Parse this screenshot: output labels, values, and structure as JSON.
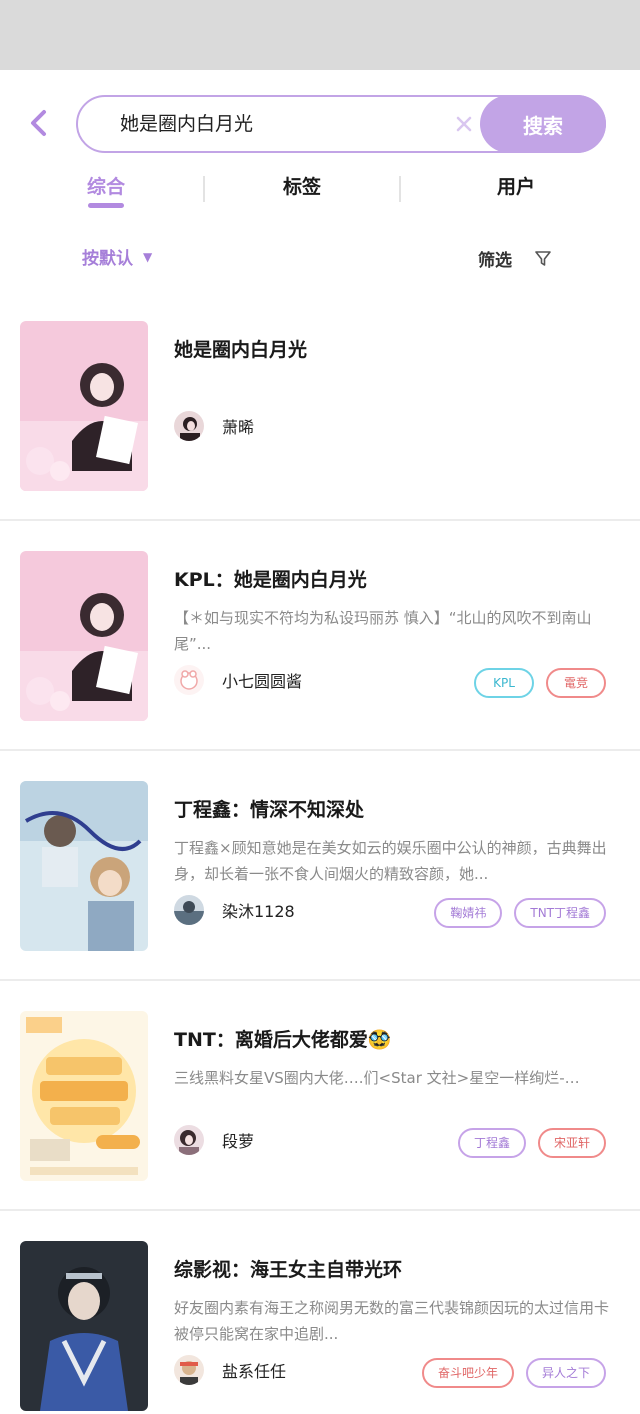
{
  "search": {
    "query": "她是圈内白月光",
    "button_label": "搜索"
  },
  "tabs": [
    {
      "label": "综合",
      "active": true
    },
    {
      "label": "标签",
      "active": false
    },
    {
      "label": "用户",
      "active": false
    }
  ],
  "filters": {
    "sort_label": "按默认",
    "filter_label": "筛选"
  },
  "results": [
    {
      "title": "她是圈内白月光",
      "description": "",
      "author": "萧晞",
      "tags": []
    },
    {
      "title": "KPL：她是圈内白月光",
      "description": "【＊如与现实不符均为私设玛丽苏 慎入】“北山的风吹不到南山尾”...",
      "author": "小七圆圆酱",
      "tags": [
        "KPL",
        "電竞"
      ]
    },
    {
      "title": "丁程鑫：情深不知深处",
      "description": "丁程鑫×顾知意她是在美女如云的娱乐圈中公认的神颜，古典舞出身，却长着一张不食人间烟火的精致容颜，她...",
      "author": "染沐1128",
      "tags": [
        "鞠婧祎",
        "TNT丁程鑫"
      ]
    },
    {
      "title": "TNT：离婚后大佬都爱🥸",
      "description": "三线黑料女星VS圈内大佬….们<Star 文社>星空一样绚烂-…",
      "author": "段萝",
      "tags": [
        "丁程鑫",
        "宋亚轩"
      ]
    },
    {
      "title": "综影视：海王女主自带光环",
      "description": "好友圈内素有海王之称阅男无数的富三代裴锦颜因玩的太过信用卡被停只能窝在家中追剧...",
      "author": "盐系任任",
      "tags": [
        "奋斗吧少年",
        "异人之下"
      ]
    }
  ],
  "colors": {
    "accent": "#c2a4e6",
    "accent_text": "#b28ae0",
    "status_bar": "#dadada"
  }
}
